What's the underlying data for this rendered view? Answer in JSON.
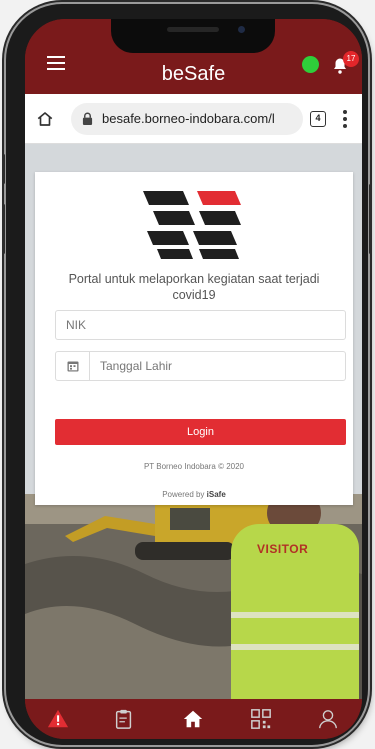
{
  "app": {
    "title": "beSafe",
    "notification_count": "17",
    "status_color": "#2fce3a",
    "brand_color": "#7a1a1b"
  },
  "browser": {
    "url": "besafe.borneo-indobara.com/l",
    "tab_count": "4"
  },
  "login": {
    "tagline": "Portal untuk melaporkan kegiatan saat terjadi covid19",
    "nik_placeholder": "NIK",
    "dob_placeholder": "Tanggal Lahir",
    "login_label": "Login",
    "copyright": "PT Borneo Indobara © 2020",
    "powered_prefix": "Powered by",
    "powered_brand": "iSafe"
  },
  "scene": {
    "vest_text": "VISITOR"
  },
  "bottom_nav": {
    "items": [
      "alert-icon",
      "clipboard-icon",
      "home-icon",
      "qr-code-icon",
      "profile-icon"
    ]
  }
}
